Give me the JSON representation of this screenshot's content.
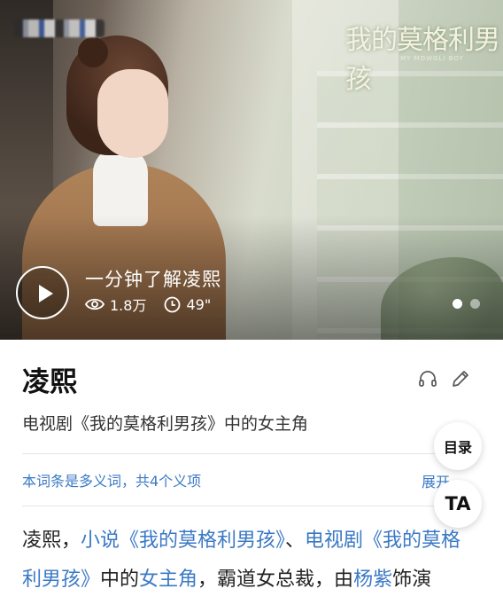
{
  "hero": {
    "drama_logo": "我的莫格利男孩",
    "drama_logo_sub": "MY MOWGLI BOY",
    "video_title": "一分钟了解凌熙",
    "views": "1.8万",
    "duration": "49\"",
    "page_count": 2,
    "active_page": 0
  },
  "entry": {
    "title": "凌熙",
    "subtitle": "电视剧《我的莫格利男孩》中的女主角",
    "polysemy": "本词条是多义词，共4个义项",
    "expand_label": "展开"
  },
  "floating": {
    "toc_label": "目录",
    "ta_label": "TA"
  },
  "body": {
    "p1": "凌熙，",
    "link_novel": "小说《我的莫格利男孩》",
    "p2": "、",
    "link_tv": "电视剧《我的莫格利男孩》",
    "p3": "中的",
    "link_lead": "女主角",
    "p4": "，霸道女总裁，由",
    "link_actor": "杨紫",
    "p5": "饰演"
  },
  "colors": {
    "link": "#3b79c5",
    "title": "#111111",
    "text": "#222222"
  },
  "icons": [
    "play-icon",
    "eye-icon",
    "clock-icon",
    "headphones-icon",
    "pencil-icon",
    "chevron-down-icon"
  ]
}
